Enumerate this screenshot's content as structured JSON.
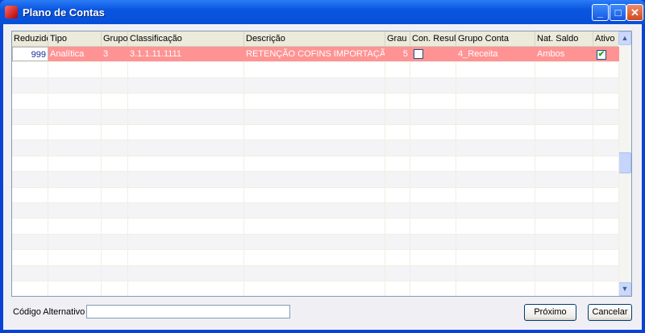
{
  "window": {
    "title": "Plano de Contas",
    "minimize": "_",
    "maximize": "□",
    "close": "✕"
  },
  "grid": {
    "columns": [
      "Reduzido",
      "Tipo",
      "Grupo",
      "Classificação",
      "Descrição",
      "Grau",
      "Con. Result.",
      "Grupo Conta",
      "Nat. Saldo",
      "Ativo"
    ],
    "row": {
      "reduzido": "999",
      "tipo": "Analítica",
      "grupo": "3",
      "classificacao": "3.1.1.11.1111",
      "descricao": "RETENÇÃO COFINS IMPORTAÇÃO",
      "grau": "5",
      "con_result": false,
      "grupo_conta": "4_Receita",
      "nat_saldo": "Ambos",
      "ativo": true
    }
  },
  "footer": {
    "codigo_label": "Código Alternativo",
    "codigo_value": "",
    "proximo": "Próximo",
    "cancelar": "Cancelar"
  },
  "colors": {
    "selected_row": "#ff9393",
    "title_bar": "#0a55e0"
  }
}
